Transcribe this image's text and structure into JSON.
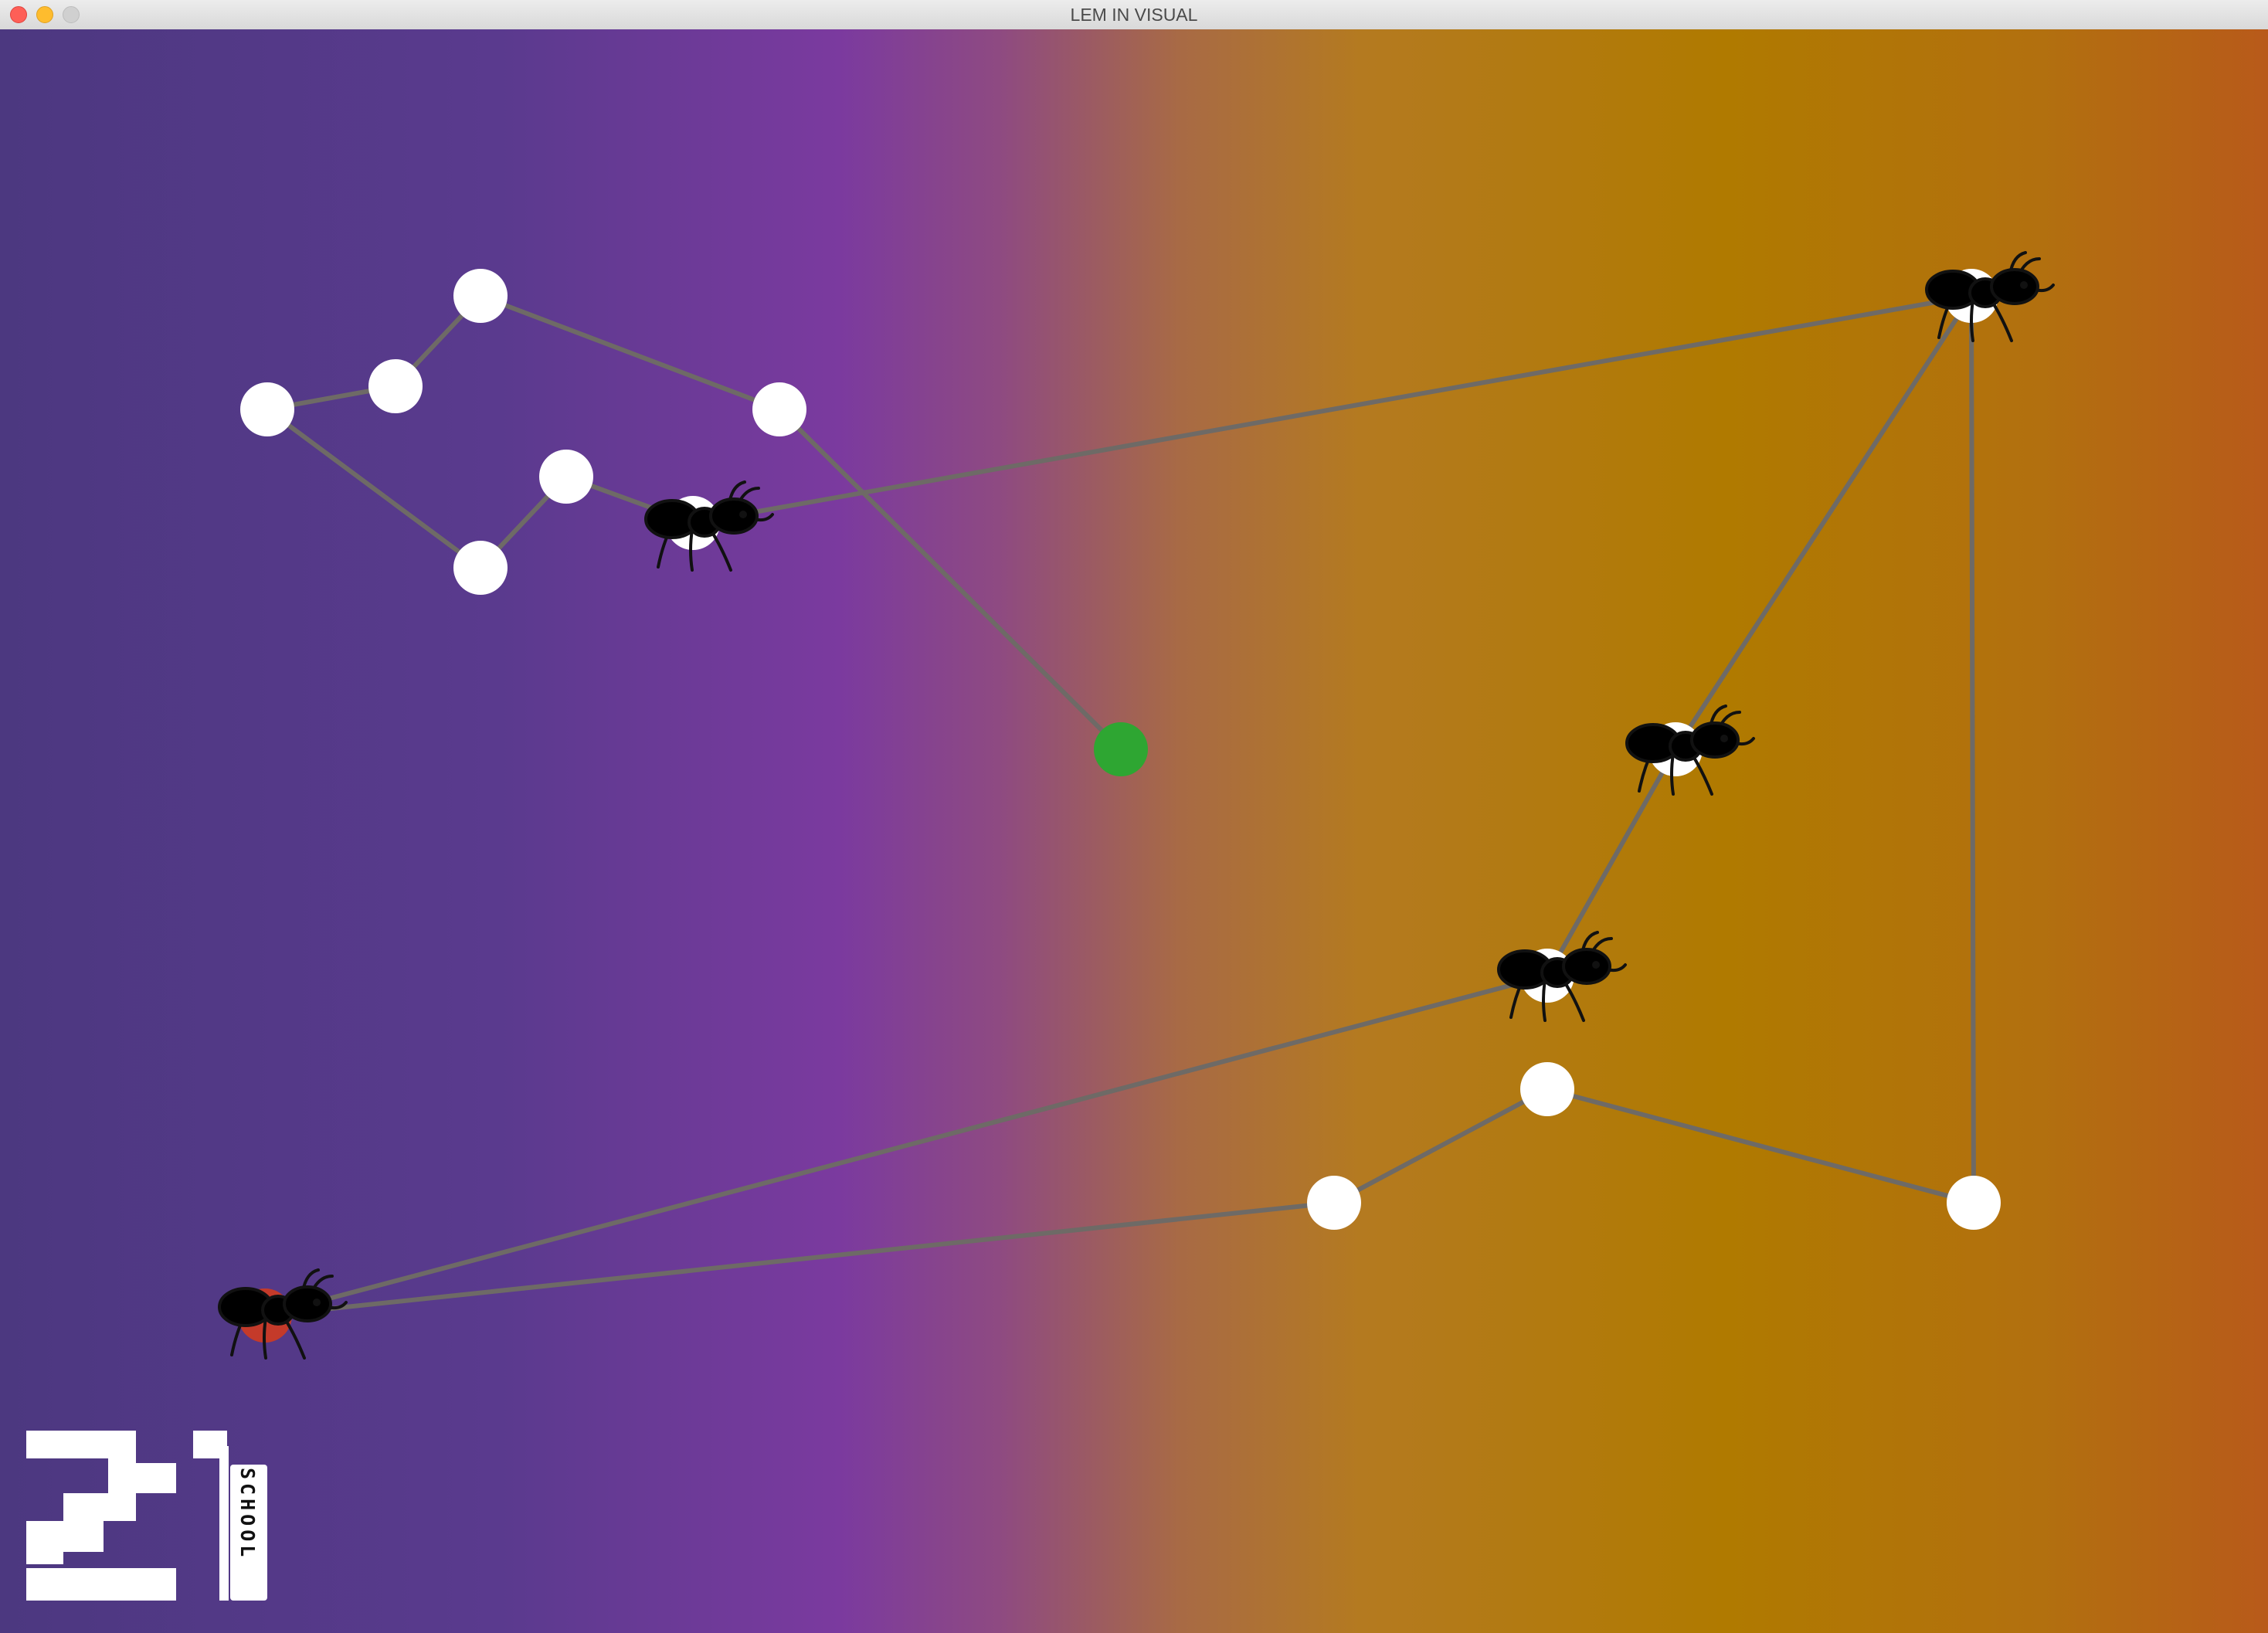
{
  "window": {
    "title": "LEM IN VISUAL"
  },
  "logo": {
    "number": "21",
    "word": "SCHOOL"
  },
  "colors": {
    "room": "#ffffff",
    "link": "#6e6a66",
    "end_room": "#2ea632",
    "ants": [
      "purple",
      "green",
      "crimson",
      "orange",
      "dark-red"
    ]
  }
}
